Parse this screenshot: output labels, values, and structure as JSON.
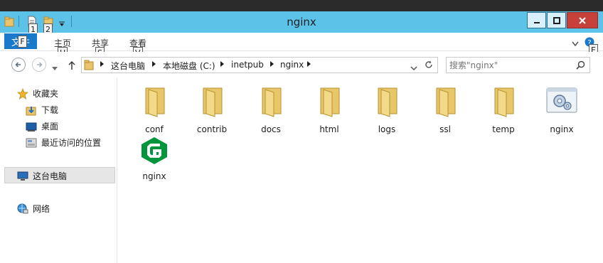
{
  "window": {
    "title": "nginx"
  },
  "quick_access": {
    "keytips": [
      "1",
      "2"
    ]
  },
  "ribbon": {
    "file_tab": "文件",
    "tabs": [
      {
        "label": "主页",
        "keytip": "H"
      },
      {
        "label": "共享",
        "keytip": "S"
      },
      {
        "label": "查看",
        "keytip": "V"
      }
    ],
    "file_keytip": "F",
    "help_keytip": "E"
  },
  "address": {
    "crumbs": [
      "这台电脑",
      "本地磁盘 (C:)",
      "inetpub",
      "nginx"
    ]
  },
  "search": {
    "placeholder": "搜索\"nginx\""
  },
  "nav": {
    "favorites": "收藏夹",
    "downloads": "下载",
    "desktop": "桌面",
    "recent": "最近访问的位置",
    "this_pc": "这台电脑",
    "network": "网络"
  },
  "files": [
    {
      "name": "conf",
      "type": "folder"
    },
    {
      "name": "contrib",
      "type": "folder"
    },
    {
      "name": "docs",
      "type": "folder"
    },
    {
      "name": "html",
      "type": "folder"
    },
    {
      "name": "logs",
      "type": "folder"
    },
    {
      "name": "ssl",
      "type": "folder"
    },
    {
      "name": "temp",
      "type": "folder"
    },
    {
      "name": "nginx",
      "type": "config-file"
    },
    {
      "name": "nginx",
      "type": "nginx-exe"
    }
  ],
  "colors": {
    "titlebar": "#5cc2e8",
    "file_tab": "#1979ca",
    "close_button": "#c7413a",
    "nginx_green": "#009639"
  }
}
